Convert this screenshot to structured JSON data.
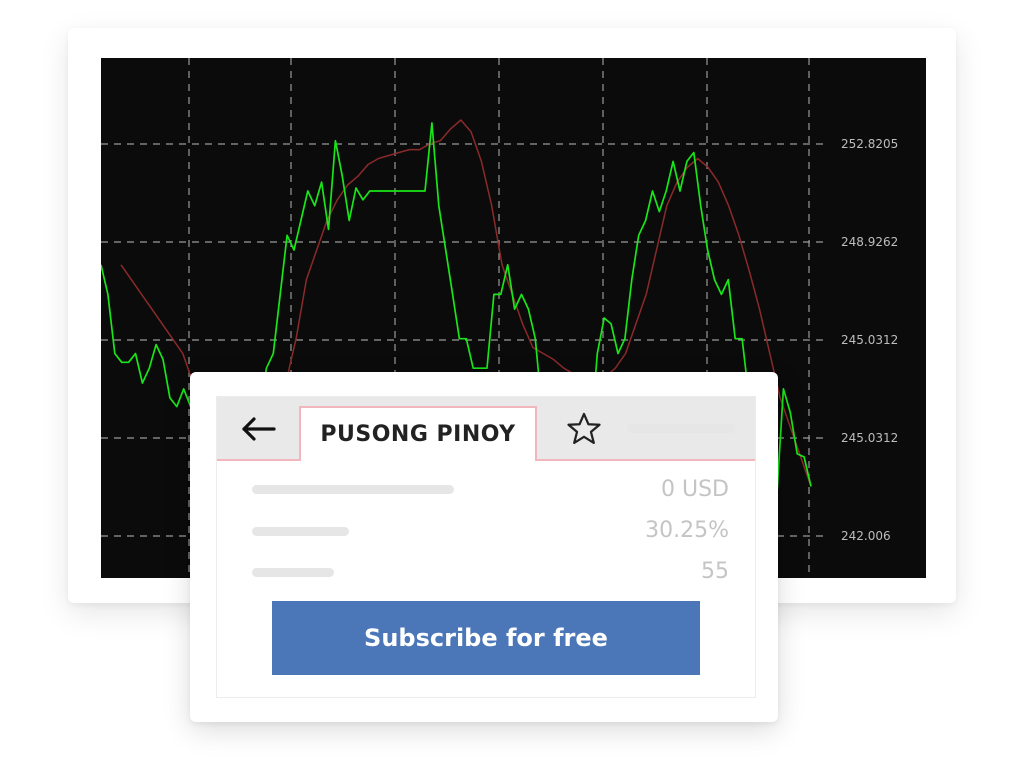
{
  "chart_data": {
    "type": "line",
    "y_tick_labels": [
      "252.8205",
      "248.9262",
      "245.0312",
      "245.0312",
      "242.006"
    ],
    "grid": true,
    "background": "#0b0b0b",
    "series": [
      {
        "color": "#19e619",
        "values": [
          249,
          248,
          246,
          245.7,
          245.7,
          246,
          245,
          245.5,
          246.3,
          245.8,
          244.5,
          244.2,
          244.8,
          244.2,
          243.5,
          242.5,
          242,
          241.5,
          241,
          240.5,
          240.5,
          241,
          242,
          244,
          245.5,
          246,
          248,
          250,
          249.5,
          250.5,
          251.5,
          251,
          251.8,
          250.2,
          253.2,
          252,
          250.5,
          251.6,
          251.2,
          251.5,
          251.5,
          251.5,
          251.5,
          251.5,
          251.5,
          251.5,
          251.5,
          251.5,
          253.8,
          251,
          249.5,
          248,
          246.5,
          246.5,
          245.5,
          245.5,
          245.5,
          248,
          248,
          249,
          247.5,
          248,
          247.5,
          246.5,
          244,
          242,
          240,
          240.3,
          240.2,
          240.5,
          241.5,
          243,
          246,
          247.2,
          247,
          246,
          246.5,
          248.5,
          250,
          250.5,
          251.5,
          250.8,
          251.5,
          252.5,
          251.5,
          252.5,
          252.8,
          251,
          249.5,
          248.5,
          248,
          248.5,
          246.5,
          246.5,
          244.5,
          242.5,
          243,
          241.5,
          241,
          244.8,
          244,
          242.6,
          242.5,
          241.5
        ]
      },
      {
        "color": "#8b2a2a",
        "values": [
          249,
          248.5,
          248,
          247.5,
          247,
          246.5,
          246,
          245,
          244.5,
          244,
          243.5,
          243,
          242.5,
          242,
          243,
          244,
          245,
          246.5,
          248.5,
          249.5,
          250.5,
          251.2,
          251.7,
          252,
          252.4,
          252.6,
          252.7,
          252.8,
          252.9,
          252.9,
          253.1,
          253.2,
          253.6,
          253.9,
          253.5,
          252.5,
          251,
          249,
          248,
          247,
          246.2,
          246,
          245.8,
          245.5,
          245.3,
          245.2,
          245.1,
          245.2,
          245.5,
          246,
          247,
          248,
          249.5,
          251,
          251.8,
          252.3,
          252.6,
          252.3,
          251.8,
          251,
          250,
          248.8,
          247.5,
          246,
          244.5,
          243.5,
          242.5,
          241.5
        ]
      }
    ]
  },
  "panel": {
    "back_icon": "arrow-left-icon",
    "tab_title": "PUSONG PINOY",
    "star_icon": "star-icon",
    "stats": [
      "0 USD",
      "30.25%",
      "55"
    ],
    "subscribe_label": "Subscribe for free",
    "accent": "#4b76b8",
    "tab_border": "#f2b6bd"
  }
}
